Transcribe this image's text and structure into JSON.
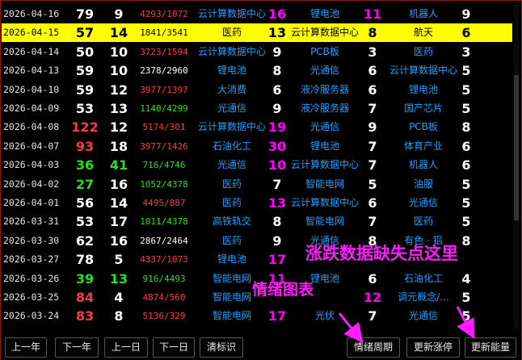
{
  "rows": [
    {
      "date": "2026-04-16",
      "n1": "79",
      "n1_color": "white",
      "n2": "9",
      "n2_color": "white",
      "ratio": "4293/1072",
      "ratio_color": "red",
      "s1": "云计算数据中心",
      "v1": "16",
      "v1_color": "mag",
      "s2": "锂电池",
      "v2": "11",
      "v2_color": "mag",
      "s3": "机器人",
      "v3": "9",
      "v3_color": "white"
    },
    {
      "date": "2026-04-15",
      "n1": "57",
      "n1_color": "black",
      "n2": "14",
      "n2_color": "black",
      "ratio": "1841/3541",
      "ratio_color": "black",
      "s1": "医药",
      "v1": "13",
      "v1_color": "black",
      "s2": "云计算数据中心",
      "v2": "8",
      "v2_color": "black",
      "s3": "航天",
      "v3": "6",
      "v3_color": "black",
      "selected": true
    },
    {
      "date": "2026-04-14",
      "n1": "50",
      "n1_color": "white",
      "n2": "10",
      "n2_color": "white",
      "ratio": "3723/1594",
      "ratio_color": "red",
      "s1": "云计算数据中心",
      "v1": "9",
      "v1_color": "white",
      "s2": "PCB板",
      "v2": "3",
      "v2_color": "white",
      "s3": "医药",
      "v3": "3",
      "v3_color": "white"
    },
    {
      "date": "2026-04-13",
      "n1": "59",
      "n1_color": "white",
      "n2": "10",
      "n2_color": "white",
      "ratio": "2378/2960",
      "ratio_color": "white",
      "s1": "锂电池",
      "v1": "8",
      "v1_color": "white",
      "s2": "光通信",
      "v2": "6",
      "v2_color": "white",
      "s3": "云计算数据中心",
      "v3": "5",
      "v3_color": "white"
    },
    {
      "date": "2026-04-10",
      "n1": "59",
      "n1_color": "white",
      "n2": "12",
      "n2_color": "white",
      "ratio": "3977/1397",
      "ratio_color": "red",
      "s1": "大消费",
      "v1": "6",
      "v1_color": "white",
      "s2": "液冷服务器",
      "v2": "6",
      "v2_color": "white",
      "s3": "锂电池",
      "v3": "5",
      "v3_color": "white"
    },
    {
      "date": "2026-04-09",
      "n1": "53",
      "n1_color": "white",
      "n2": "13",
      "n2_color": "white",
      "ratio": "1140/4299",
      "ratio_color": "green",
      "s1": "光通信",
      "v1": "9",
      "v1_color": "white",
      "s2": "液冷服务器",
      "v2": "7",
      "v2_color": "white",
      "s3": "国产芯片",
      "v3": "5",
      "v3_color": "white"
    },
    {
      "date": "2026-04-08",
      "n1": "122",
      "n1_color": "red",
      "n2": "12",
      "n2_color": "white",
      "ratio": "5174/301",
      "ratio_color": "red",
      "s1": "云计算数据中心",
      "v1": "19",
      "v1_color": "mag",
      "s2": "光通信",
      "v2": "9",
      "v2_color": "white",
      "s3": "PCB板",
      "v3": "8",
      "v3_color": "white"
    },
    {
      "date": "2026-04-07",
      "n1": "93",
      "n1_color": "red",
      "n2": "18",
      "n2_color": "white",
      "ratio": "3977/1426",
      "ratio_color": "red",
      "s1": "石油化工",
      "v1": "30",
      "v1_color": "mag",
      "s2": "锂电池",
      "v2": "7",
      "v2_color": "white",
      "s3": "体育产业",
      "v3": "6",
      "v3_color": "white"
    },
    {
      "date": "2026-04-03",
      "n1": "36",
      "n1_color": "green",
      "n2": "41",
      "n2_color": "green",
      "ratio": "716/4746",
      "ratio_color": "green",
      "s1": "光通信",
      "v1": "10",
      "v1_color": "mag",
      "s2": "云计算数据中心",
      "v2": "7",
      "v2_color": "white",
      "s3": "机器人",
      "v3": "6",
      "v3_color": "white"
    },
    {
      "date": "2026-04-02",
      "n1": "27",
      "n1_color": "green",
      "n2": "16",
      "n2_color": "white",
      "ratio": "1052/4378",
      "ratio_color": "green",
      "s1": "医药",
      "v1": "7",
      "v1_color": "white",
      "s2": "智能电网",
      "v2": "5",
      "v2_color": "white",
      "s3": "油服",
      "v3": "5",
      "v3_color": "white"
    },
    {
      "date": "2026-04-01",
      "n1": "56",
      "n1_color": "white",
      "n2": "14",
      "n2_color": "white",
      "ratio": "4495/887",
      "ratio_color": "red",
      "s1": "医药",
      "v1": "13",
      "v1_color": "mag",
      "s2": "云计算数据中心",
      "v2": "6",
      "v2_color": "white",
      "s3": "光通信",
      "v3": "5",
      "v3_color": "white"
    },
    {
      "date": "2026-03-31",
      "n1": "53",
      "n1_color": "white",
      "n2": "17",
      "n2_color": "white",
      "ratio": "1011/4378",
      "ratio_color": "green",
      "s1": "高铁轨交",
      "v1": "8",
      "v1_color": "white",
      "s2": "智能电网",
      "v2": "7",
      "v2_color": "white",
      "s3": "医药",
      "v3": "5",
      "v3_color": "white"
    },
    {
      "date": "2026-03-30",
      "n1": "62",
      "n1_color": "white",
      "n2": "16",
      "n2_color": "white",
      "ratio": "2867/2464",
      "ratio_color": "white",
      "s1": "医药",
      "v1": "9",
      "v1_color": "white",
      "s2": "光通信",
      "v2": "8",
      "v2_color": "white",
      "s3": "有色 · 铝",
      "v3": "8",
      "v3_color": "white"
    },
    {
      "date": "2026-03-27",
      "n1": "78",
      "n1_color": "white",
      "n2": "5",
      "n2_color": "white",
      "ratio": "4337/1073",
      "ratio_color": "red",
      "s1": "锂电池",
      "v1": "17",
      "v1_color": "mag",
      "s2": "",
      "v2": "",
      "v2_color": "white",
      "s3": "",
      "v3": "",
      "v3_color": "white"
    },
    {
      "date": "2026-03-26",
      "n1": "39",
      "n1_color": "green",
      "n2": "13",
      "n2_color": "green",
      "ratio": "916/4493",
      "ratio_color": "green",
      "s1": "智能电网",
      "v1": "11",
      "v1_color": "mag",
      "s2": "锂电池",
      "v2": "6",
      "v2_color": "white",
      "s3": "石油化工",
      "v3": "4",
      "v3_color": "white"
    },
    {
      "date": "2026-03-25",
      "n1": "84",
      "n1_color": "red",
      "n2": "4",
      "n2_color": "white",
      "ratio": "4874/560",
      "ratio_color": "red",
      "s1": "智能电网",
      "v1": "",
      "v1_color": "white",
      "s2": "",
      "v2": "12",
      "v2_color": "mag",
      "s3": "调元概念/...",
      "v3": "5",
      "v3_color": "white"
    },
    {
      "date": "2026-03-24",
      "n1": "83",
      "n1_color": "red",
      "n2": "8",
      "n2_color": "white",
      "ratio": "5136/329",
      "ratio_color": "red",
      "s1": "智能电网",
      "v1": "17",
      "v1_color": "mag",
      "s2": "光伏",
      "v2": "7",
      "v2_color": "white",
      "s3": "光通信",
      "v3": "5",
      "v3_color": "white"
    }
  ],
  "annotations": {
    "missing_data_note": "涨跌数据缺失点这里",
    "sentiment_chart_note": "情绪图表"
  },
  "buttons": {
    "prev_year": "上一年",
    "next_year": "下一年",
    "prev_day": "上一日",
    "next_day": "下一日",
    "clear_marks": "清标识",
    "sentiment_cycle": "情绪周期",
    "update_limit": "更新涨停",
    "update_energy": "更新能量"
  },
  "colors": {
    "white": "#ffffff",
    "red": "#ff3a3a",
    "green": "#22e022",
    "cyan": "#1e9fff",
    "mag": "#ff00ff",
    "black": "#000000",
    "highlight": "#ffff00",
    "annotation": "#ff1dff"
  }
}
